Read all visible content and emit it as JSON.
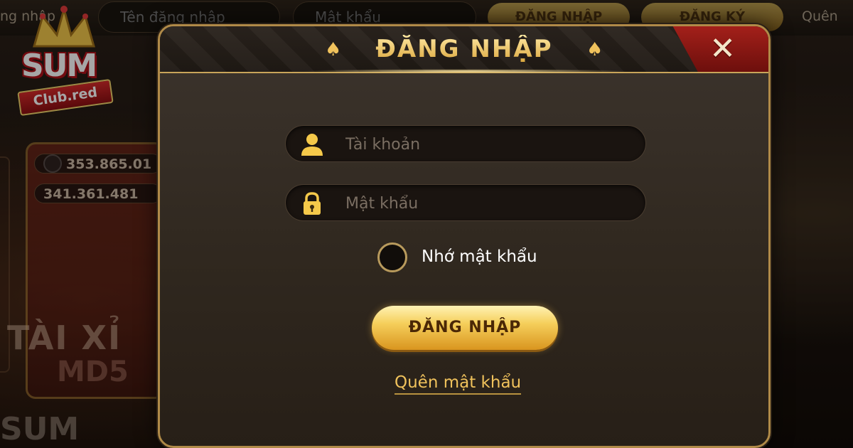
{
  "topbar": {
    "left_text": "ng nhập",
    "username_placeholder": "Tên đăng nhập",
    "password_placeholder": "Mật khẩu",
    "login_label": "ĐĂNG NHẬP",
    "register_label": "ĐĂNG KÝ",
    "forgot_label": "Quên"
  },
  "logo": {
    "brand": "SUM",
    "sub": "Club.red"
  },
  "background_game": {
    "balance_1": "353.865.01",
    "balance_2": "341.361.481",
    "title": "TÀI XỈ",
    "subtitle": "MD5",
    "bottom_logo": "SUM"
  },
  "modal": {
    "title": "ĐĂNG NHẬP",
    "close_icon": "close-x-icon",
    "username_placeholder": "Tài khoản",
    "password_placeholder": "Mật khẩu",
    "remember_label": "Nhớ mật khẩu",
    "remember_checked": false,
    "login_button": "ĐĂNG NHẬP",
    "forgot_link": "Quên mật khẩu"
  },
  "colors": {
    "gold": "#f0c25c",
    "modal_bg": "#30281f",
    "close_red": "#a3201a"
  }
}
